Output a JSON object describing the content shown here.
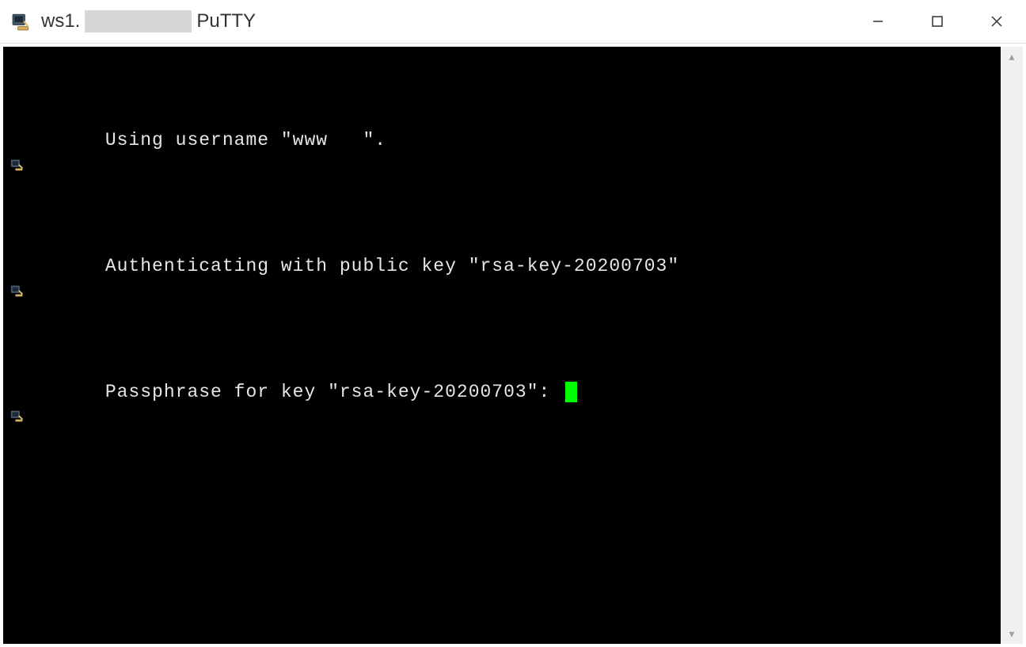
{
  "window": {
    "title_prefix": "ws1.",
    "title_app": "PuTTY"
  },
  "terminal": {
    "lines": [
      "Using username \"www   \".",
      "Authenticating with public key \"rsa-key-20200703\"",
      "Passphrase for key \"rsa-key-20200703\": "
    ]
  }
}
